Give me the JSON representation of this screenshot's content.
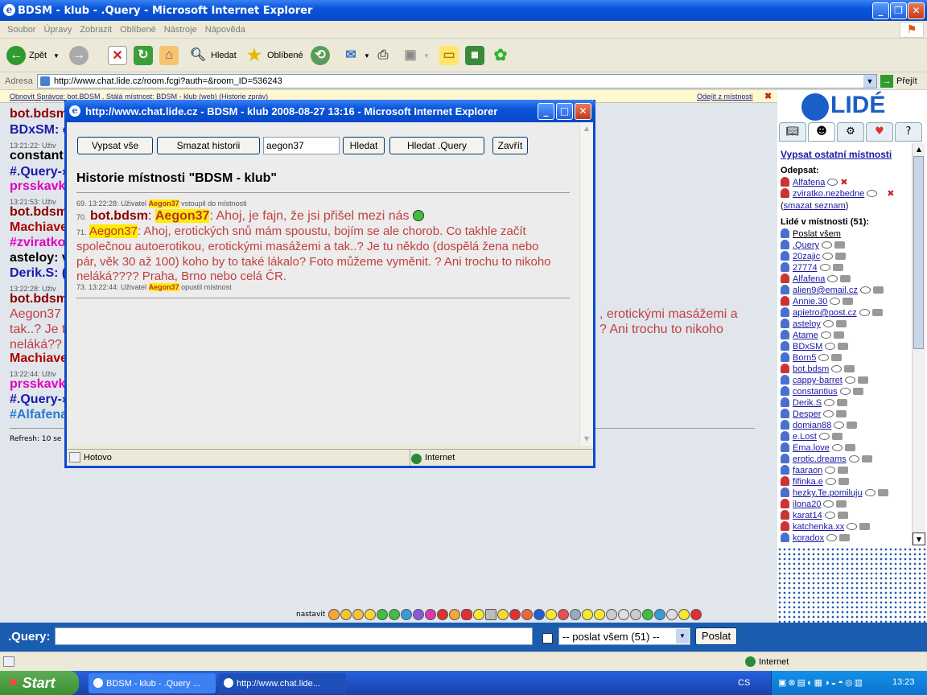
{
  "window": {
    "title": "BDSM - klub - .Query - Microsoft Internet Explorer"
  },
  "menu": [
    "Soubor",
    "Úpravy",
    "Zobrazit",
    "Oblíbené",
    "Nástroje",
    "Nápověda"
  ],
  "toolbar": {
    "back": "Zpět",
    "search": "Hledat",
    "favorites": "Oblíbené"
  },
  "address": {
    "label": "Adresa",
    "url": "http://www.chat.lide.cz/room.fcgi?auth=&room_ID=536243",
    "go": "Přejít"
  },
  "strip": {
    "left": "Obnovit   Správce: bot.BDSM . Stálá místnost: BDSM - klub (web)   (Historie zpráv)",
    "right": "Odejít z místnosti"
  },
  "chat_lines": [
    {
      "text": "bot.bdsm",
      "color": "#8b0000"
    },
    {
      "text": "BDxSM: c",
      "color": "#1a1aa6"
    },
    {
      "text": "13:21:22: Uživ",
      "small": true
    },
    {
      "text": "constant",
      "color": "#000"
    },
    {
      "text": "#.Query-›",
      "color": "#1a1aa6"
    },
    {
      "text": "prsskavk",
      "color": "#e000c0"
    },
    {
      "text": "13:21:53: Uživ",
      "small": true
    },
    {
      "text": "bot.bdsm",
      "color": "#8b0000"
    },
    {
      "text": "Machiave",
      "color": "#b00000"
    },
    {
      "text": "#zviratko",
      "color": "#e000c0"
    },
    {
      "text": "asteloy: v",
      "color": "#000"
    },
    {
      "text": "Derik.S: (",
      "color": "#1a1aa6"
    },
    {
      "text": "13:22:28: Uživ",
      "small": true
    },
    {
      "text": "bot.bdsm",
      "color": "#8b0000"
    },
    {
      "text": "Aegon37",
      "color": "#c04040"
    },
    {
      "text": "tak..? Je t",
      "color": "#c04040"
    },
    {
      "text": "neláká??",
      "color": "#c04040"
    },
    {
      "text": "Machiave",
      "color": "#b00000"
    },
    {
      "text": "13:22:44: Uživ",
      "small": true
    },
    {
      "text": "prsskavk",
      "color": "#e000c0"
    },
    {
      "text": "#.Query-›",
      "color": "#1a1aa6"
    },
    {
      "text": "#Alfafena",
      "color": "#2a7acf"
    }
  ],
  "chat_right": {
    "line1": ", erotickými masážemi a",
    "line2": "? Ani trochu to nikoho"
  },
  "refresh": "Refresh: 10 se",
  "smileys_label": "nastavit",
  "sidebar": {
    "link_rooms": "Vypsat ostatní místnosti",
    "odepsat": "Odepsat:",
    "odepsat_users": [
      "Alfafena",
      "zviratko.nezbedne"
    ],
    "clear_list": "smazat seznam",
    "people_heading": "Lidé v místnosti (51):",
    "send_all": "Poslat všem",
    "users": [
      ".Query",
      "20zajic",
      "27774",
      "Alfafena",
      "alien9@email.cz",
      "Annie.30",
      "apietro@post.cz",
      "asteloy",
      "Atame",
      "BDxSM",
      "Born5",
      "bot.bdsm",
      "cappy-barret",
      "constantius",
      "Derik.S",
      "Desper",
      "domian88",
      "e.Lost",
      "Ema.love",
      "erotic.dreams",
      "faaraon",
      "fifinka.e",
      "hezky.Te.pomiluju",
      "ilona20",
      "karat14",
      "katchenka.xx",
      "koradox"
    ]
  },
  "input": {
    "label": ".Query:",
    "recipient": "-- poslat všem (51) --",
    "send": "Poslat"
  },
  "status": {
    "zone": "Internet"
  },
  "taskbar": {
    "start": "Start",
    "task1": "BDSM - klub - .Query ...",
    "task2": "http://www.chat.lide...",
    "lang": "CS",
    "time": "13:23"
  },
  "popup": {
    "title": "http://www.chat.lide.cz - BDSM - klub 2008-08-27 13:16 - Microsoft Internet Explorer",
    "btn_all": "Vypsat vše",
    "btn_clear": "Smazat historii",
    "search_value": "aegon37",
    "btn_search": "Hledat",
    "btn_search_query": "Hledat .Query",
    "btn_close": "Zavřít",
    "heading": "Historie místnosti \"BDSM - klub\"",
    "line69_pre": "69. 13:22:28: Uživatel",
    "line69_user": "Aegon37",
    "line69_post": "vstoupil do místnosti",
    "line70_num": "70.",
    "line70_user": "bot.bdsm",
    "line70_target": "Aegon37",
    "line70_text": ": Ahoj, je fajn, že jsi přišel mezi nás",
    "line71_num": "71.",
    "line71_user": "Aegon37",
    "line71_t1": ": Ahoj, erotických snů mám spoustu, bojím se ale chorob. Co takhle začít",
    "line71_t2": "společnou autoerotikou, erotickými masážemi a tak..? Je tu někdo (dospělá žena nebo",
    "line71_t3": "pár, věk 30 až 100) koho by to také lákalo? Foto můžeme vyměnit. ? Ani trochu to nikoho",
    "line71_t4": "neláká???? Praha, Brno nebo celá ČR.",
    "line73_pre": "73. 13:22:44: Uživatel",
    "line73_user": "Aegon37",
    "line73_post": "opustil místnost",
    "status": "Hotovo",
    "zone": "Internet"
  }
}
